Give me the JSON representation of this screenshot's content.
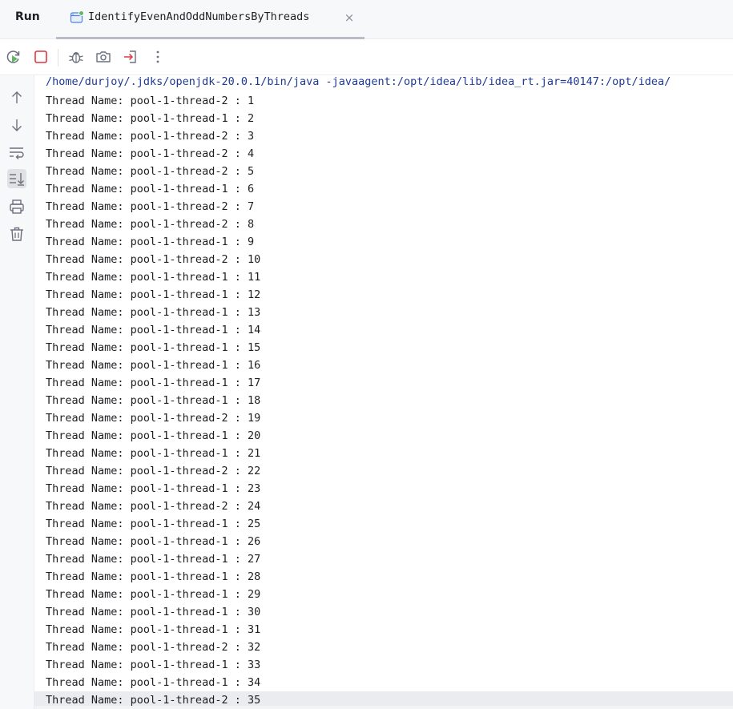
{
  "run_panel": {
    "title": "Run",
    "tab": {
      "label": "IdentifyEvenAndOddNumbersByThreads",
      "close_glyph": "×",
      "icon": "run-config-icon"
    }
  },
  "toolbar": {
    "buttons": [
      "rerun-icon",
      "stop-icon",
      "debug-icon",
      "screenshot-icon",
      "exit-icon",
      "more-icon"
    ]
  },
  "gutter": {
    "buttons": [
      "arrow-up-icon",
      "arrow-down-icon",
      "soft-wrap-icon",
      "scroll-to-end-icon",
      "print-icon",
      "trash-icon"
    ],
    "active": "scroll-to-end-icon"
  },
  "colors": {
    "command_text": "#1f3a93",
    "output_text": "#1e1f22",
    "active_button_bg": "#dfe1e5"
  },
  "console": {
    "command": "/home/durjoy/.jdks/openjdk-20.0.1/bin/java -javaagent:/opt/idea/lib/idea_rt.jar=40147:/opt/idea/",
    "lines": [
      "Thread Name: pool-1-thread-2 : 1",
      "Thread Name: pool-1-thread-1 : 2",
      "Thread Name: pool-1-thread-2 : 3",
      "Thread Name: pool-1-thread-2 : 4",
      "Thread Name: pool-1-thread-2 : 5",
      "Thread Name: pool-1-thread-1 : 6",
      "Thread Name: pool-1-thread-2 : 7",
      "Thread Name: pool-1-thread-2 : 8",
      "Thread Name: pool-1-thread-1 : 9",
      "Thread Name: pool-1-thread-2 : 10",
      "Thread Name: pool-1-thread-1 : 11",
      "Thread Name: pool-1-thread-1 : 12",
      "Thread Name: pool-1-thread-1 : 13",
      "Thread Name: pool-1-thread-1 : 14",
      "Thread Name: pool-1-thread-1 : 15",
      "Thread Name: pool-1-thread-1 : 16",
      "Thread Name: pool-1-thread-1 : 17",
      "Thread Name: pool-1-thread-1 : 18",
      "Thread Name: pool-1-thread-2 : 19",
      "Thread Name: pool-1-thread-1 : 20",
      "Thread Name: pool-1-thread-1 : 21",
      "Thread Name: pool-1-thread-2 : 22",
      "Thread Name: pool-1-thread-1 : 23",
      "Thread Name: pool-1-thread-2 : 24",
      "Thread Name: pool-1-thread-1 : 25",
      "Thread Name: pool-1-thread-1 : 26",
      "Thread Name: pool-1-thread-1 : 27",
      "Thread Name: pool-1-thread-1 : 28",
      "Thread Name: pool-1-thread-1 : 29",
      "Thread Name: pool-1-thread-1 : 30",
      "Thread Name: pool-1-thread-1 : 31",
      "Thread Name: pool-1-thread-2 : 32",
      "Thread Name: pool-1-thread-1 : 33",
      "Thread Name: pool-1-thread-1 : 34",
      "Thread Name: pool-1-thread-2 : 35"
    ]
  }
}
